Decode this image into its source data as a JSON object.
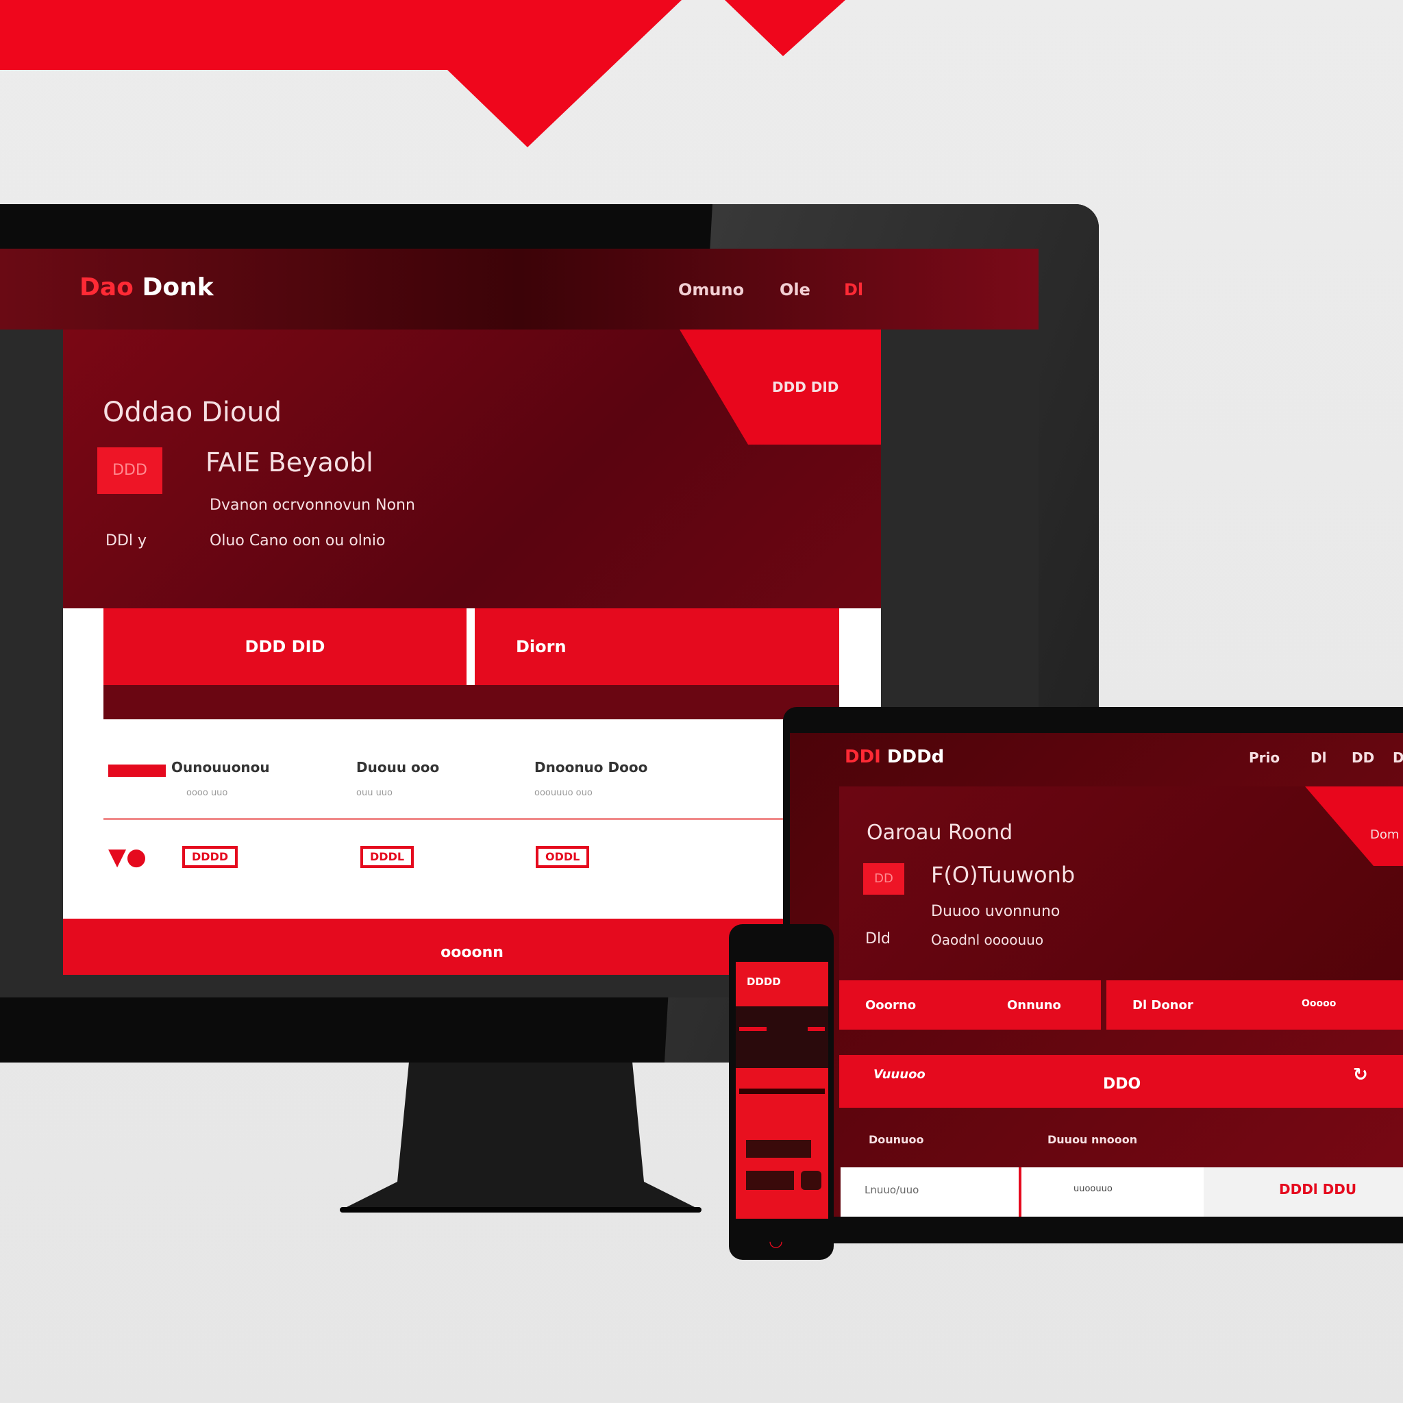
{
  "colors": {
    "accent": "#e50a1e",
    "dark": "#5a0410",
    "background": "#e9e9e9"
  },
  "desktop": {
    "logo": {
      "mark": "Dao",
      "name": "Donk"
    },
    "nav": [
      "Omuno",
      "Ole",
      "Dl"
    ],
    "hero": {
      "title": "Oddao Dioud",
      "corner_label": "DDD DID",
      "icon_label": "DDD",
      "subtitle": "FAIE Beyaobl",
      "line1": "Dvanon ocrvonnovun Nonn",
      "label2": "DDl y",
      "line2": "Oluo Cano oon ou olnio"
    },
    "buttons": [
      "DDD DID",
      "Diorn"
    ],
    "features": [
      {
        "title": "Ounouuonou",
        "sub": "oooo uuo"
      },
      {
        "title": "Duouu ooo",
        "sub": "ouu  uuo"
      },
      {
        "title": "Dnoonuo Dooo",
        "sub": "ooouuuo  ouo"
      }
    ],
    "pills": [
      "DDDD",
      "DDDL",
      "ODDL"
    ],
    "footer": "oooonn"
  },
  "tablet": {
    "logo": {
      "mark": "DDI",
      "name": "DDDd"
    },
    "nav": [
      "Prio",
      "Dl",
      "DD",
      "D"
    ],
    "hero": {
      "title": "Oaroau Roond",
      "corner_label": "Dom",
      "icon_label": "DD",
      "subtitle": "F(O)Tuuwonb",
      "line1": "Duuoo uvonnuno",
      "label2": "Dld",
      "line2": "Oaodnl oooouuo"
    },
    "buttons": [
      "Ooorno",
      "Onnuno",
      "Dl Donor",
      "Ooooo"
    ],
    "bar": {
      "left": "Vuuuoo",
      "center": "DDO"
    },
    "labels": [
      "Dounuoo",
      "Duuou nnooon"
    ],
    "cells": [
      "Lnuuo/uuo",
      "uuoouuo",
      "DDDl DDU"
    ]
  },
  "phone": {
    "header": "DDDD"
  }
}
